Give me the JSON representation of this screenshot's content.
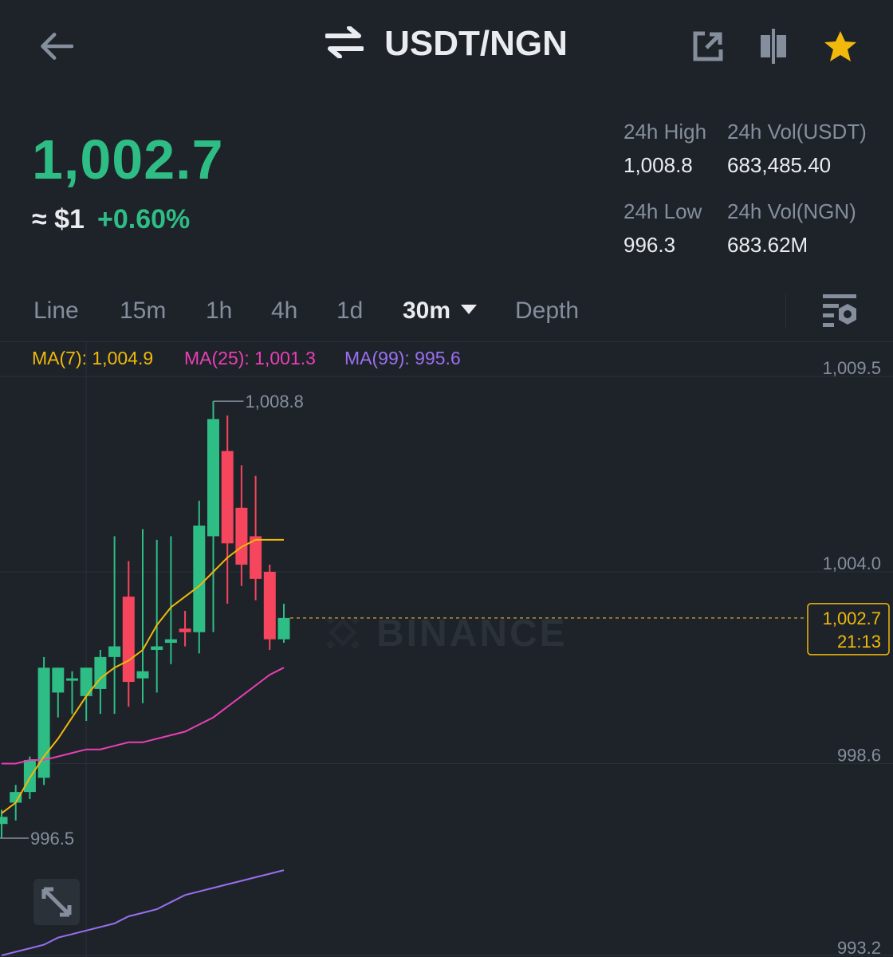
{
  "header": {
    "pair": "USDT/NGN",
    "icons": [
      "back-arrow-icon",
      "swap-icon",
      "share-icon",
      "candlestick-icon",
      "star-icon"
    ],
    "star_color": "#f0b90b"
  },
  "ticker": {
    "last_price": "1,002.7",
    "usd_equiv": "≈ $1",
    "change": "+0.60%",
    "price_color": "#2ebd85",
    "high_label": "24h High",
    "high_value": "1,008.8",
    "low_label": "24h Low",
    "low_value": "996.3",
    "vol_usdt_label": "24h Vol(USDT)",
    "vol_usdt_value": "683,485.40",
    "vol_ngn_label": "24h Vol(NGN)",
    "vol_ngn_value": "683.62M"
  },
  "tabs": {
    "items": [
      "Line",
      "15m",
      "1h",
      "4h",
      "1d",
      "30m",
      "Depth"
    ],
    "active": "30m"
  },
  "indicators": {
    "ma7": "MA(7): 1,004.9",
    "ma25": "MA(25): 1,001.3",
    "ma99": "MA(99): 995.6",
    "ma7_color": "#f0b90b",
    "ma25_color": "#e93fb5",
    "ma99_color": "#9a6ff0"
  },
  "chart_data": {
    "type": "candlestick",
    "y_ticks": [
      "1,009.5",
      "1,004.0",
      "998.6",
      "993.2"
    ],
    "y_tick_values": [
      1009.5,
      1004.0,
      998.6,
      993.2
    ],
    "high_marker": "1,008.8",
    "low_marker": "996.5",
    "current_price_label": "1,002.7",
    "countdown_label": "21:13",
    "watermark": "BINANCE",
    "up_color": "#2ebd85",
    "down_color": "#f6465d",
    "candles": [
      {
        "o": 996.9,
        "h": 997.3,
        "l": 996.5,
        "c": 997.1
      },
      {
        "o": 997.5,
        "h": 998.0,
        "l": 997.0,
        "c": 997.8
      },
      {
        "o": 997.8,
        "h": 998.8,
        "l": 997.6,
        "c": 998.7
      },
      {
        "o": 998.2,
        "h": 1001.6,
        "l": 998.0,
        "c": 1001.3
      },
      {
        "o": 1000.6,
        "h": 1001.3,
        "l": 999.9,
        "c": 1001.3
      },
      {
        "o": 1001.0,
        "h": 1001.2,
        "l": 1000.0,
        "c": 1001.0
      },
      {
        "o": 1000.5,
        "h": 1001.3,
        "l": 999.8,
        "c": 1001.3
      },
      {
        "o": 1000.7,
        "h": 1001.8,
        "l": 1000.0,
        "c": 1001.6
      },
      {
        "o": 1001.6,
        "h": 1005.0,
        "l": 1000.0,
        "c": 1001.9
      },
      {
        "o": 1003.3,
        "h": 1004.3,
        "l": 1000.2,
        "c": 1000.9
      },
      {
        "o": 1001.0,
        "h": 1005.2,
        "l": 1000.3,
        "c": 1001.2
      },
      {
        "o": 1001.8,
        "h": 1004.9,
        "l": 1000.6,
        "c": 1001.9
      },
      {
        "o": 1002.0,
        "h": 1005.0,
        "l": 1001.4,
        "c": 1002.1
      },
      {
        "o": 1002.4,
        "h": 1002.9,
        "l": 1001.9,
        "c": 1002.3
      },
      {
        "o": 1002.3,
        "h": 1006.0,
        "l": 1001.7,
        "c": 1005.3
      },
      {
        "o": 1005.0,
        "h": 1008.8,
        "l": 1002.3,
        "c": 1008.3
      },
      {
        "o": 1007.4,
        "h": 1008.4,
        "l": 1003.1,
        "c": 1004.8
      },
      {
        "o": 1005.8,
        "h": 1007.0,
        "l": 1003.6,
        "c": 1004.2
      },
      {
        "o": 1005.0,
        "h": 1006.7,
        "l": 1003.2,
        "c": 1003.8
      },
      {
        "o": 1004.0,
        "h": 1004.2,
        "l": 1001.8,
        "c": 1002.1
      },
      {
        "o": 1002.1,
        "h": 1003.1,
        "l": 1002.0,
        "c": 1002.7
      }
    ],
    "ma7_values": [
      997.2,
      997.5,
      998.2,
      998.8,
      999.3,
      999.9,
      1000.5,
      1001.0,
      1001.3,
      1001.5,
      1001.8,
      1002.5,
      1003.0,
      1003.3,
      1003.6,
      1004.0,
      1004.4,
      1004.7,
      1004.9,
      1004.9,
      1004.9
    ],
    "ma25_values": [
      998.6,
      998.6,
      998.7,
      998.7,
      998.8,
      998.9,
      999.0,
      999.0,
      999.1,
      999.2,
      999.2,
      999.3,
      999.4,
      999.5,
      999.7,
      999.9,
      1000.2,
      1000.5,
      1000.8,
      1001.1,
      1001.3
    ],
    "ma99_values": [
      993.2,
      993.3,
      993.4,
      993.5,
      993.7,
      993.8,
      993.9,
      994.0,
      994.1,
      994.3,
      994.4,
      994.5,
      994.7,
      994.9,
      995.0,
      995.1,
      995.2,
      995.3,
      995.4,
      995.5,
      995.6
    ]
  }
}
